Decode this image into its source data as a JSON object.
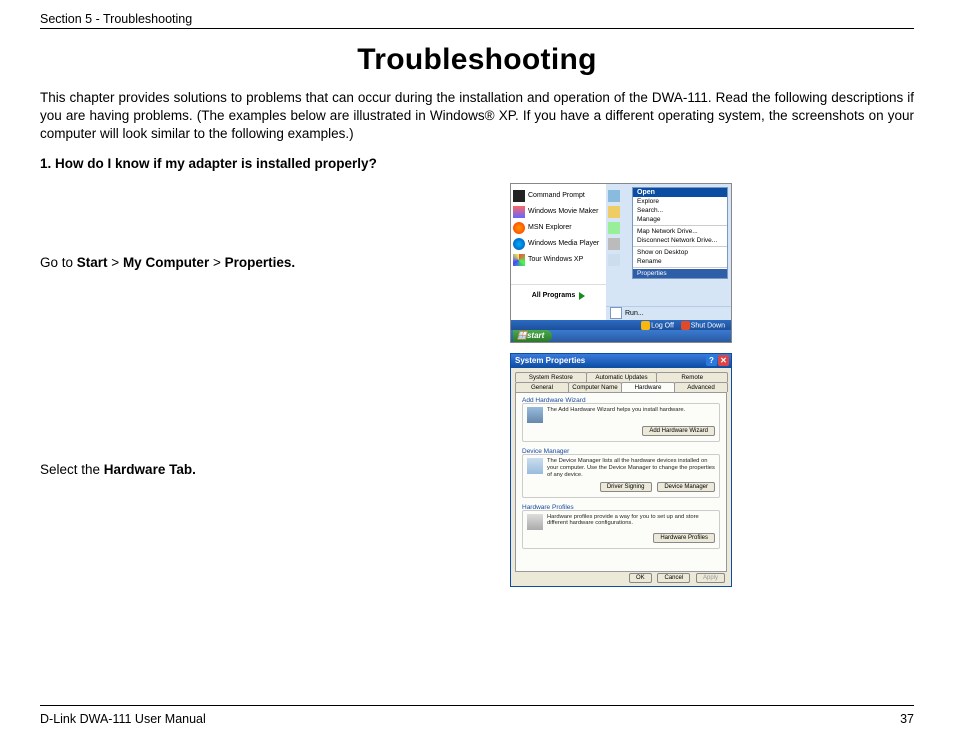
{
  "header": {
    "section": "Section 5 - Troubleshooting"
  },
  "title": "Troubleshooting",
  "intro": "This chapter provides solutions to problems that can occur during the installation and operation of the DWA-111.  Read the following descriptions if you are having problems.  (The examples below are illustrated in Windows® XP.  If you have a different operating system, the screenshots on your computer will look similar to the following examples.)",
  "q1": "1.  How do I know if my adapter is installed properly?",
  "step1": {
    "prefix": "Go to ",
    "path1": "Start",
    "sep1": " > ",
    "path2": "My Computer",
    "sep2": " > ",
    "path3": "Properties."
  },
  "step2": {
    "prefix": "Select the ",
    "bold": "Hardware Tab."
  },
  "start_menu": {
    "left_items": [
      "Command Prompt",
      "Windows Movie Maker",
      "MSN Explorer",
      "Windows Media Player",
      "Tour Windows XP"
    ],
    "all_programs": "All Programs",
    "right_icons_rows": 5,
    "context_top": "Open",
    "context_items": [
      "Explore",
      "Search...",
      "Manage",
      "Map Network Drive...",
      "Disconnect Network Drive...",
      "Show on Desktop",
      "Rename"
    ],
    "context_selected": "Properties",
    "run": "Run...",
    "logoff": "Log Off",
    "shutdown": "Shut Down",
    "start": "start"
  },
  "sysprop": {
    "title": "System Properties",
    "tabs_row1": [
      "System Restore",
      "Automatic Updates",
      "Remote"
    ],
    "tabs_row2": [
      "General",
      "Computer Name",
      "Hardware",
      "Advanced"
    ],
    "active_tab": "Hardware",
    "group1": {
      "title": "Add Hardware Wizard",
      "text": "The Add Hardware Wizard helps you install hardware.",
      "btn": "Add Hardware Wizard"
    },
    "group2": {
      "title": "Device Manager",
      "text": "The Device Manager lists all the hardware devices installed on your computer. Use the Device Manager to change the properties of any device.",
      "btn1": "Driver Signing",
      "btn2": "Device Manager"
    },
    "group3": {
      "title": "Hardware Profiles",
      "text": "Hardware profiles provide a way for you to set up and store different hardware configurations.",
      "btn": "Hardware Profiles"
    },
    "ok": "OK",
    "cancel": "Cancel",
    "apply": "Apply"
  },
  "footer": {
    "manual": "D-Link DWA-111 User Manual",
    "page": "37"
  }
}
